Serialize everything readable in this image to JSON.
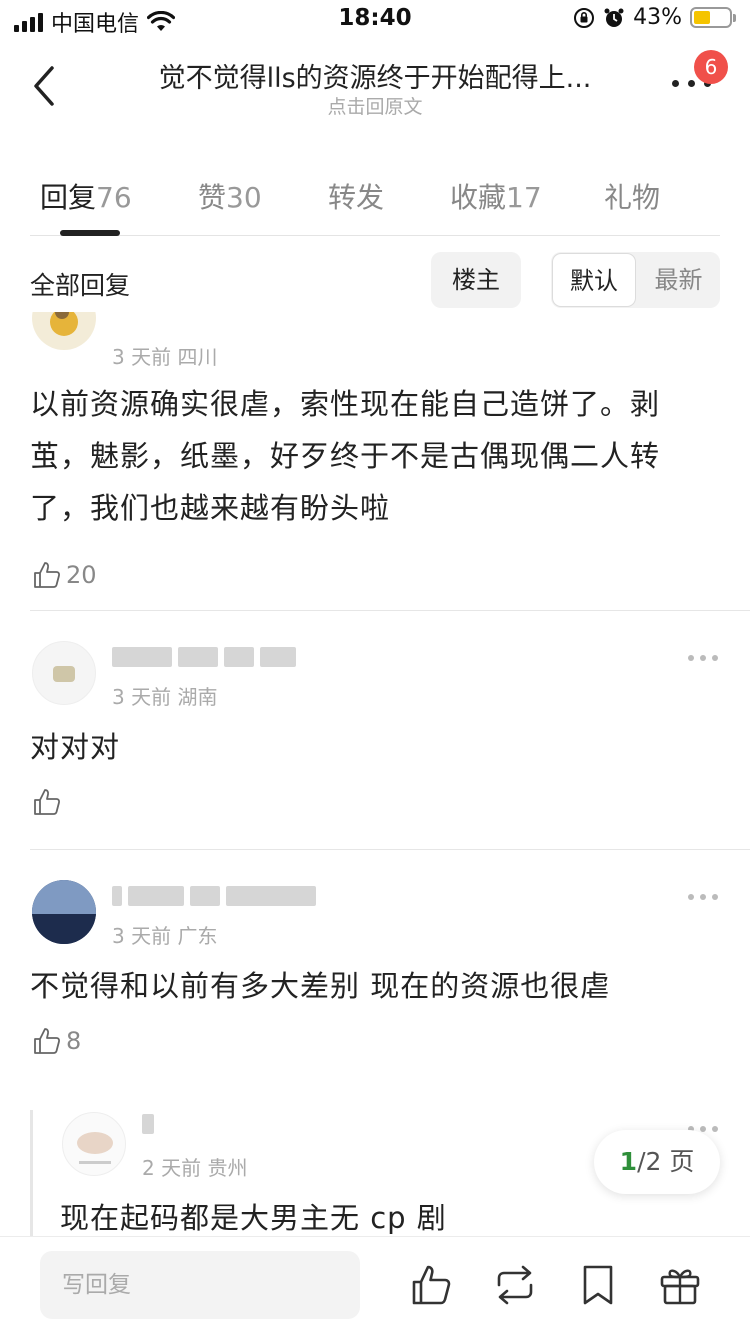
{
  "status_bar": {
    "carrier": "中国电信",
    "time": "18:40",
    "battery_percent": "43%"
  },
  "header": {
    "title": "觉不觉得lls的资源终于开始配得上...",
    "subtitle": "点击回原文",
    "notification_count": "6"
  },
  "tabs": [
    {
      "label": "回复",
      "count": "76"
    },
    {
      "label": "赞",
      "count": "30"
    },
    {
      "label": "转发",
      "count": ""
    },
    {
      "label": "收藏",
      "count": "17"
    },
    {
      "label": "礼物",
      "count": ""
    }
  ],
  "filter": {
    "label": "全部回复",
    "op_only": "楼主",
    "sort_default": "默认",
    "sort_latest": "最新"
  },
  "comments": [
    {
      "meta": "3 天前 四川",
      "body_lines": [
        "以前资源确实很虐，索性现在能自己造饼了。剥",
        "茧，魅影，纸墨，好歹终于不是古偶现偶二人转",
        "了，我们也越来越有盼头啦"
      ],
      "likes": "20"
    },
    {
      "meta": "3 天前 湖南",
      "body_lines": [
        "对对对"
      ],
      "likes": ""
    },
    {
      "meta": "3 天前 广东",
      "body_lines": [
        "不觉得和以前有多大差别 现在的资源也很虐"
      ],
      "likes": "8"
    },
    {
      "meta": "2 天前 贵州",
      "body_lines": [
        "现在起码都是大男主无 cp 剧"
      ],
      "likes": ""
    }
  ],
  "pager": {
    "current": "1",
    "total_text": "/2 页"
  },
  "bottom_bar": {
    "reply_placeholder": "写回复"
  },
  "colors": {
    "badge": "#f0504a",
    "pager_current": "#2f8f3a",
    "battery": "#f5c400"
  }
}
